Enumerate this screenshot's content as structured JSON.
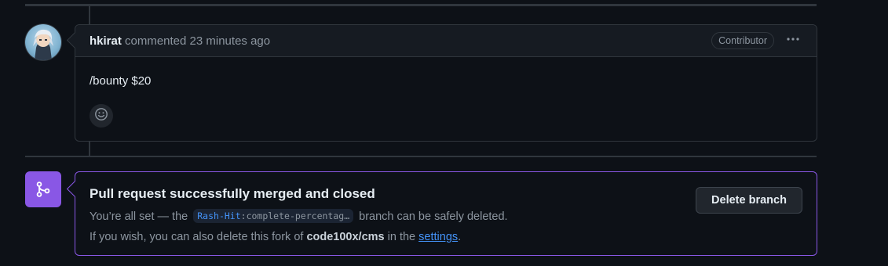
{
  "comment": {
    "author": "hkirat",
    "meta": "commented 23 minutes ago",
    "badge": "Contributor",
    "more_icon": "kebab-horizontal-icon",
    "body": "/bounty $20",
    "reaction_icon": "smiley-icon"
  },
  "merge": {
    "icon": "git-merge-icon",
    "title": "Pull request successfully merged and closed",
    "line1_prefix": "You’re all set — the",
    "branch_owner": "Rash-Hit",
    "branch_name": ":complete-percentag…",
    "line1_suffix": "branch can be safely deleted.",
    "line2_prefix": "If you wish, you can also delete this fork of",
    "repo": "code100x/cms",
    "line2_mid": "in the",
    "settings_link": "settings",
    "line2_end": ".",
    "delete_button": "Delete branch",
    "accent_color": "#8957e5"
  }
}
